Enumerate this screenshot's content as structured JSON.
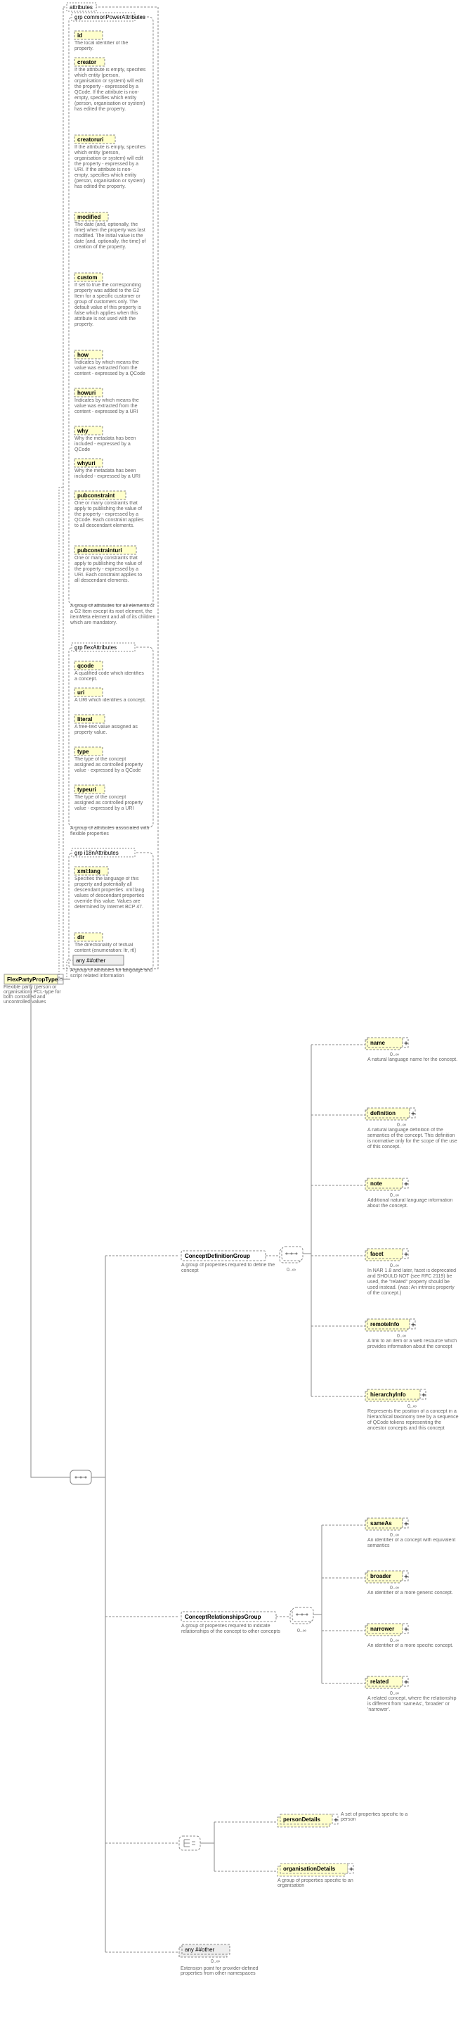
{
  "root": {
    "type_name": "FlexPartyPropType",
    "type_desc": "Flexible party (person or organisation) PCL-type for both controlled and uncontrolled values",
    "attributes_label": "attributes",
    "any_other_attr": "any  ##other"
  },
  "groups": {
    "cpa": {
      "legend": "grp  commonPowerAttributes",
      "attrs": [
        {
          "name": "id",
          "desc": "The local identifier of the property."
        },
        {
          "name": "creator",
          "desc": "If the attribute is empty, specifies which entity (person, organisation or system) will edit the property - expressed by a QCode. If the attribute is non-empty, specifies which entity (person, organisation or system) has edited the property."
        },
        {
          "name": "creatoruri",
          "desc": "If the attribute is empty, specifies which entity (person, organisation or system) will edit the property - expressed by a URI. If the attribute is non-empty, specifies which entity (person, organisation or system) has edited the property."
        },
        {
          "name": "modified",
          "desc": "The date (and, optionally, the time) when the property was last modified. The initial value is the date (and, optionally, the time) of creation of the property."
        },
        {
          "name": "custom",
          "desc": "If set to true the corresponding property was added to the G2 Item for a specific customer or group of customers only. The default value of this property is false which applies when this attribute is not used with the property."
        },
        {
          "name": "how",
          "desc": "Indicates by which means the value was extracted from the content - expressed by a QCode"
        },
        {
          "name": "howuri",
          "desc": "Indicates by which means the value was extracted from the content - expressed by a URI"
        },
        {
          "name": "why",
          "desc": "Why the metadata has been included - expressed by a QCode"
        },
        {
          "name": "whyuri",
          "desc": "Why the metadata has been included - expressed by a URI"
        },
        {
          "name": "pubconstraint",
          "desc": "One or many constraints that apply to publishing the value of the property - expressed by a QCode. Each constraint applies to all descendant elements."
        },
        {
          "name": "pubconstrainturi",
          "desc": "One or many constraints that apply to publishing the value of the property - expressed by a URI. Each constraint applies to all descendant elements."
        }
      ],
      "footer": "A group of attributes for all elements of a G2 Item except its root element, the itemMeta element and all of its children which are mandatory."
    },
    "flex": {
      "legend": "grp  flexAttributes",
      "attrs": [
        {
          "name": "qcode",
          "desc": "A qualified code which identifies a concept."
        },
        {
          "name": "uri",
          "desc": "A URI which identifies a concept."
        },
        {
          "name": "literal",
          "desc": "A free-text value assigned as property value."
        },
        {
          "name": "type",
          "desc": "The type of the concept assigned as controlled property value - expressed by a QCode"
        },
        {
          "name": "typeuri",
          "desc": "The type of the concept assigned as controlled property value - expressed by a URI"
        }
      ],
      "footer": "A group of attributes associated with flexible properties"
    },
    "i18n": {
      "legend": "grp  i18nAttributes",
      "attrs": [
        {
          "name": "xml:lang",
          "desc": "Specifies the language of this property and potentially all descendant properties. xml:lang values of descendant properties override this value. Values are determined by Internet BCP 47."
        },
        {
          "name": "dir",
          "desc": "The directionality of textual content (enumeration: ltr, rtl)"
        }
      ],
      "footer": "A group of attributes for language and script related information"
    }
  },
  "cdg": {
    "name": "ConceptDefinitionGroup",
    "card": "0..∞",
    "desc": "A group of properites required to define the concept",
    "children": [
      {
        "name": "name",
        "desc": "A natural language name for the concept."
      },
      {
        "name": "definition",
        "desc": "A natural language definition of the semantics of the concept. This definition is normative only for the scope of the use of this concept."
      },
      {
        "name": "note",
        "desc": "Additional natural language information about the concept."
      },
      {
        "name": "facet",
        "desc": "In NAR 1.8 and later, facet is deprecated and SHOULD NOT (see RFC 2119) be used, the \"related\" property should be used instead. (was: An intrinsic property of the concept.)"
      },
      {
        "name": "remoteInfo",
        "desc": "A link to an item or a web resource which provides information about the concept"
      },
      {
        "name": "hierarchyInfo",
        "desc": "Represents the position of a concept in a hierarchical taxonomy tree by a sequence of QCode tokens representing the ancestor concepts and this concept"
      }
    ]
  },
  "crg": {
    "name": "ConceptRelationshipsGroup",
    "card": "0..∞",
    "desc": "A group of properites required to indicate relationships of the concept to other concepts",
    "children": [
      {
        "name": "sameAs",
        "desc": "An identifier of a concept with equivalent semantics"
      },
      {
        "name": "broader",
        "desc": "An identifier of a more generic concept."
      },
      {
        "name": "narrower",
        "desc": "An identifier of a more specific concept."
      },
      {
        "name": "related",
        "desc": "A related concept, where the relationship is different from 'sameAs', 'broader' or 'narrower'."
      }
    ]
  },
  "details": {
    "person": {
      "name": "personDetails",
      "desc": "A set of properties specific to a person"
    },
    "org": {
      "name": "organisationDetails",
      "desc": "A group of properties specific to an organisation"
    }
  },
  "ext": {
    "name": "any  ##other",
    "card": "0..∞",
    "desc": "Extension point for provider-defined properties from other namespaces"
  }
}
